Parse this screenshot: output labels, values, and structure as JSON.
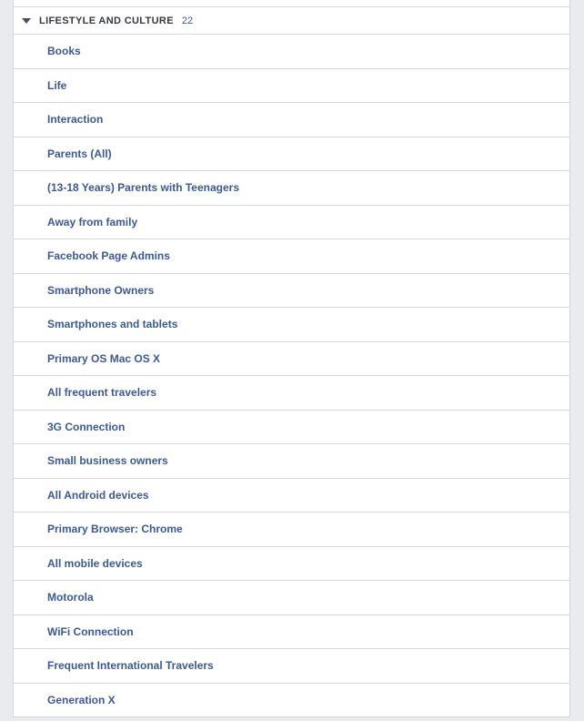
{
  "panel": {
    "background_color": "#ffffff",
    "page_background_color": "#e9ebee",
    "border_color": "#d3d6db",
    "link_color": "#3b5998",
    "header_text_color": "#35383f"
  },
  "section": {
    "caret_icon": "triangle-down-icon",
    "title": "LIFESTYLE AND CULTURE",
    "count": "22",
    "expanded": true
  },
  "items": [
    {
      "label": "Books"
    },
    {
      "label": "Life"
    },
    {
      "label": "Interaction"
    },
    {
      "label": "Parents (All)"
    },
    {
      "label": "(13-18 Years) Parents with Teenagers"
    },
    {
      "label": "Away from family"
    },
    {
      "label": "Facebook Page Admins"
    },
    {
      "label": "Smartphone Owners"
    },
    {
      "label": "Smartphones and tablets"
    },
    {
      "label": "Primary OS Mac OS X"
    },
    {
      "label": "All frequent travelers"
    },
    {
      "label": "3G Connection"
    },
    {
      "label": "Small business owners"
    },
    {
      "label": "All Android devices"
    },
    {
      "label": "Primary Browser: Chrome"
    },
    {
      "label": "All mobile devices"
    },
    {
      "label": "Motorola"
    },
    {
      "label": "WiFi Connection"
    },
    {
      "label": "Frequent International Travelers"
    },
    {
      "label": "Generation X"
    }
  ]
}
